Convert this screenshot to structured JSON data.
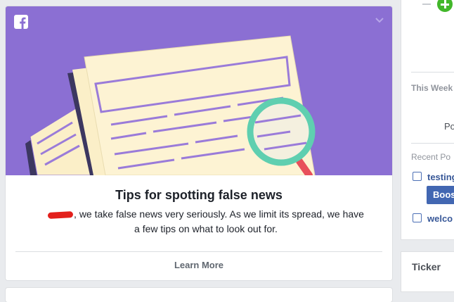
{
  "card": {
    "headline": "Tips for spotting false news",
    "description": ", we take false news very seriously. As we limit its spread, we have a few tips on what to look out for.",
    "learn_more": "Learn More",
    "brand_color": "#8b6fd3"
  },
  "sidebar": {
    "this_week": "This Week",
    "posts_short": "Po",
    "recent_posts": "Recent Po",
    "items": [
      {
        "label": "testing"
      },
      {
        "label": "welco"
      }
    ],
    "boost_label": "Boos"
  },
  "ticker": {
    "label": "Ticker"
  }
}
